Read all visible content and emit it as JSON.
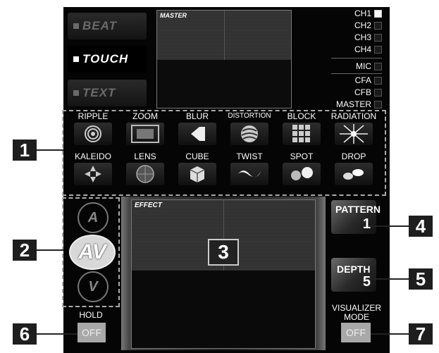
{
  "modes": [
    {
      "label": "BEAT",
      "active": false
    },
    {
      "label": "TOUCH",
      "active": true
    },
    {
      "label": "TEXT",
      "active": false
    }
  ],
  "master_screen": {
    "label": "MASTER"
  },
  "channels": [
    {
      "label": "CH1",
      "on": true
    },
    {
      "label": "CH2",
      "on": false
    },
    {
      "label": "CH3",
      "on": false
    },
    {
      "label": "CH4",
      "on": false
    },
    {
      "label": "MIC",
      "on": false
    },
    {
      "label": "CFA",
      "on": false
    },
    {
      "label": "CFB",
      "on": false
    },
    {
      "label": "MASTER",
      "on": false
    }
  ],
  "effects_row1": [
    "RIPPLE",
    "ZOOM",
    "BLUR",
    "DISTORTION",
    "BLOCK",
    "RADIATION"
  ],
  "effects_row2": [
    "KALEIDO",
    "LENS",
    "CUBE",
    "TWIST",
    "SPOT",
    "DROP"
  ],
  "effect_screen": {
    "label": "EFFECT"
  },
  "param_buttons": {
    "a": "A",
    "av": "AV",
    "v": "V"
  },
  "pattern_button": {
    "label": "PATTERN",
    "value": "1"
  },
  "depth_button": {
    "label": "DEPTH",
    "value": "5"
  },
  "hold": {
    "label": "HOLD",
    "value": "OFF"
  },
  "visualizer_mode": {
    "label_line1": "VISUALIZER",
    "label_line2": "MODE",
    "value": "OFF"
  },
  "callouts": [
    "1",
    "2",
    "3",
    "4",
    "5",
    "6",
    "7"
  ]
}
